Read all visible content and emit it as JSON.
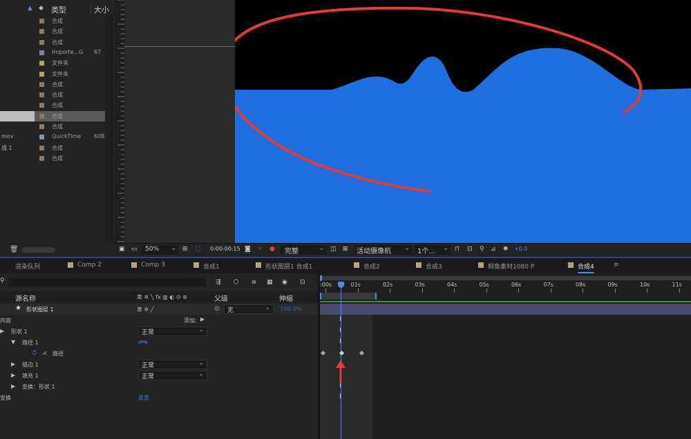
{
  "project": {
    "header": {
      "type_label": "类型",
      "size_label": "大小"
    },
    "rows": [
      {
        "name": "",
        "type": "合成",
        "size": "",
        "color": "#8b7b5d"
      },
      {
        "name": "",
        "type": "合成",
        "size": "",
        "color": "#8b7b5d"
      },
      {
        "name": "",
        "type": "合成",
        "size": "",
        "color": "#8b7b5d"
      },
      {
        "name": "",
        "type": "Importe...G",
        "size": "67",
        "color": "#8080a8"
      },
      {
        "name": "",
        "type": "文件夹",
        "size": "",
        "color": "#b8a84a"
      },
      {
        "name": "",
        "type": "文件夹",
        "size": "",
        "color": "#b8a84a"
      },
      {
        "name": "",
        "type": "合成",
        "size": "",
        "color": "#8b7b5d"
      },
      {
        "name": "",
        "type": "合成",
        "size": "",
        "color": "#8b7b5d"
      },
      {
        "name": "",
        "type": "合成",
        "size": "",
        "color": "#8b7b5d"
      },
      {
        "name": "",
        "type": "合成",
        "size": "",
        "color": "#8b7b5d"
      },
      {
        "name": "",
        "type": "合成",
        "size": "",
        "color": "#8b7b5d"
      },
      {
        "name": "mov",
        "type": "QuickTime",
        "size": "608",
        "color": "#7a98a8"
      },
      {
        "name": "成 1",
        "type": "合成",
        "size": "",
        "color": "#8b7b5d"
      },
      {
        "name": "",
        "type": "合成",
        "size": "",
        "color": "#8b7b5d"
      }
    ]
  },
  "viewer": {
    "zoom": "50%",
    "timecode": "0:00:00:15",
    "quality": "完整",
    "camera": "活动摄像机",
    "views": "1个...",
    "exposure": "+0.0"
  },
  "tabs": [
    "渲染队列",
    "Comp 2",
    "Comp 3",
    "合成1",
    "形状图层1 合成1",
    "合成2",
    "合成3",
    "鲟鱼素材1080 P",
    "合成4"
  ],
  "active_tab_index": 8,
  "timeline": {
    "headers": {
      "source_name": "源名称",
      "parent": "父级",
      "stretch": "伸缩"
    },
    "layer": {
      "name": "形状图层 1",
      "parent": "无",
      "stretch": "100.0%"
    },
    "contents_label": "内容",
    "add_label": "添加:",
    "props": {
      "shape": "形状 1",
      "path_group": "路径 1",
      "path": "路径",
      "stroke": "描边 1",
      "fill": "填充 1",
      "transform_shape": "变换：形状 1",
      "transform": "变换",
      "reset": "重置"
    },
    "blend_modes": {
      "shape": "正常",
      "stroke": "正常",
      "fill": "正常"
    },
    "ruler_ticks": [
      ":00s",
      "01s",
      "02s",
      "03s",
      "04s",
      "05s",
      "06s",
      "07s",
      "08s",
      "09s",
      "10s",
      "11s"
    ]
  },
  "colors": {
    "blue_shape": "#1f6fe0",
    "annotation_red": "#e43a3a",
    "layer_bar": "#4a4a72",
    "work_area": "#3a7ae0"
  }
}
